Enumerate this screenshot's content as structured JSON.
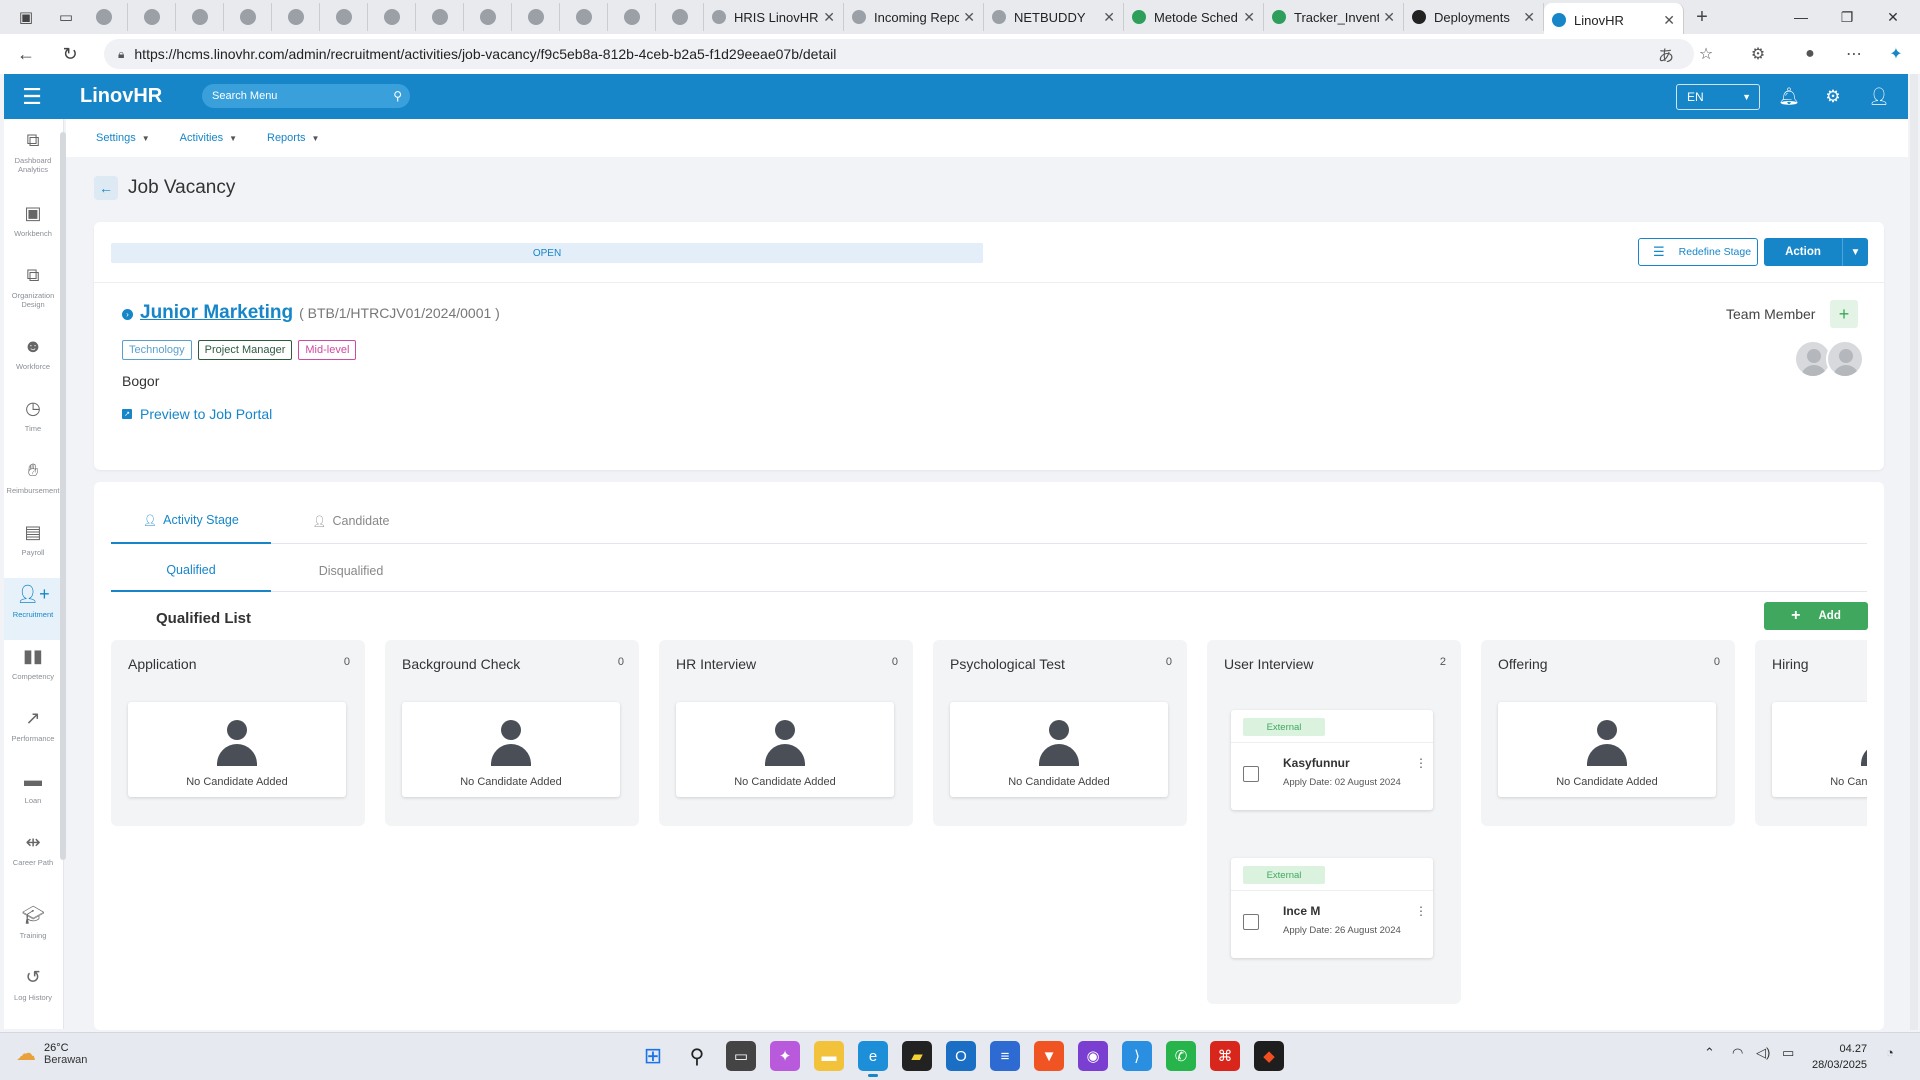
{
  "browser": {
    "tabs": [
      {
        "label": "HRIS LinovHR",
        "active": false
      },
      {
        "label": "Incoming Repo",
        "active": false
      },
      {
        "label": "NETBUDDY",
        "active": false
      },
      {
        "label": "Metode Sched",
        "active": false
      },
      {
        "label": "Tracker_Invent",
        "active": false
      },
      {
        "label": "Deployments",
        "active": false
      },
      {
        "label": "LinovHR",
        "active": true
      }
    ],
    "url": "https://hcms.linovhr.com/admin/recruitment/activities/job-vacancy/f9c5eb8a-812b-4ceb-b2a5-f1d29eeae07b/detail"
  },
  "app": {
    "logo": "LinovHR",
    "search_placeholder": "Search Menu",
    "language": "EN",
    "brand_color": "#1686c9"
  },
  "sidebar": {
    "items": [
      {
        "label": "Dashboard Analytics",
        "icon": "sitemap-icon"
      },
      {
        "label": "Workbench",
        "icon": "briefcase-icon"
      },
      {
        "label": "Organization Design",
        "icon": "org-chart-icon"
      },
      {
        "label": "Workforce",
        "icon": "users-icon"
      },
      {
        "label": "Time",
        "icon": "clock-icon"
      },
      {
        "label": "Reimbursement",
        "icon": "hand-money-icon"
      },
      {
        "label": "Payroll",
        "icon": "money-bill-icon"
      },
      {
        "label": "Recruitment",
        "icon": "user-plus-icon",
        "active": true
      },
      {
        "label": "Competency",
        "icon": "bar-chart-icon"
      },
      {
        "label": "Performance",
        "icon": "line-chart-icon"
      },
      {
        "label": "Loan",
        "icon": "card-icon"
      },
      {
        "label": "Career Path",
        "icon": "signpost-icon"
      },
      {
        "label": "Training",
        "icon": "graduation-cap-icon"
      },
      {
        "label": "Log History",
        "icon": "history-icon"
      }
    ]
  },
  "subnav": {
    "settings": "Settings",
    "activities": "Activities",
    "reports": "Reports"
  },
  "page": {
    "title": "Job Vacancy"
  },
  "job": {
    "status": "OPEN",
    "redefine_stage": "Redefine Stage",
    "action": "Action",
    "title": "Junior Marketing",
    "code": "( BTB/1/HTRCJV01/2024/0001 )",
    "tags": [
      "Technology",
      "Project Manager",
      "Mid-level"
    ],
    "location": "Bogor",
    "preview_link": "Preview to Job Portal",
    "team_member_label": "Team Member"
  },
  "tabs": {
    "activity_stage": "Activity Stage",
    "candidate": "Candidate",
    "qualified": "Qualified",
    "disqualified": "Disqualified"
  },
  "qualified_list": {
    "title": "Qualified List",
    "add_label": "Add",
    "empty_text": "No Candidate Added",
    "stages": [
      {
        "name": "Application",
        "count": "0"
      },
      {
        "name": "Background Check",
        "count": "0"
      },
      {
        "name": "HR Interview",
        "count": "0"
      },
      {
        "name": "Psychological Test",
        "count": "0"
      },
      {
        "name": "User Interview",
        "count": "2"
      },
      {
        "name": "Offering",
        "count": "0"
      },
      {
        "name": "Hiring",
        "count": ""
      }
    ],
    "candidates": [
      {
        "badge": "External",
        "name": "Kasyfunnur",
        "apply_date": "Apply Date: 02 August 2024"
      },
      {
        "badge": "External",
        "name": "Ince M",
        "apply_date": "Apply Date: 26 August 2024"
      }
    ]
  },
  "taskbar": {
    "temperature": "26°C",
    "weather": "Berawan",
    "time": "04.27",
    "date": "28/03/2025"
  }
}
